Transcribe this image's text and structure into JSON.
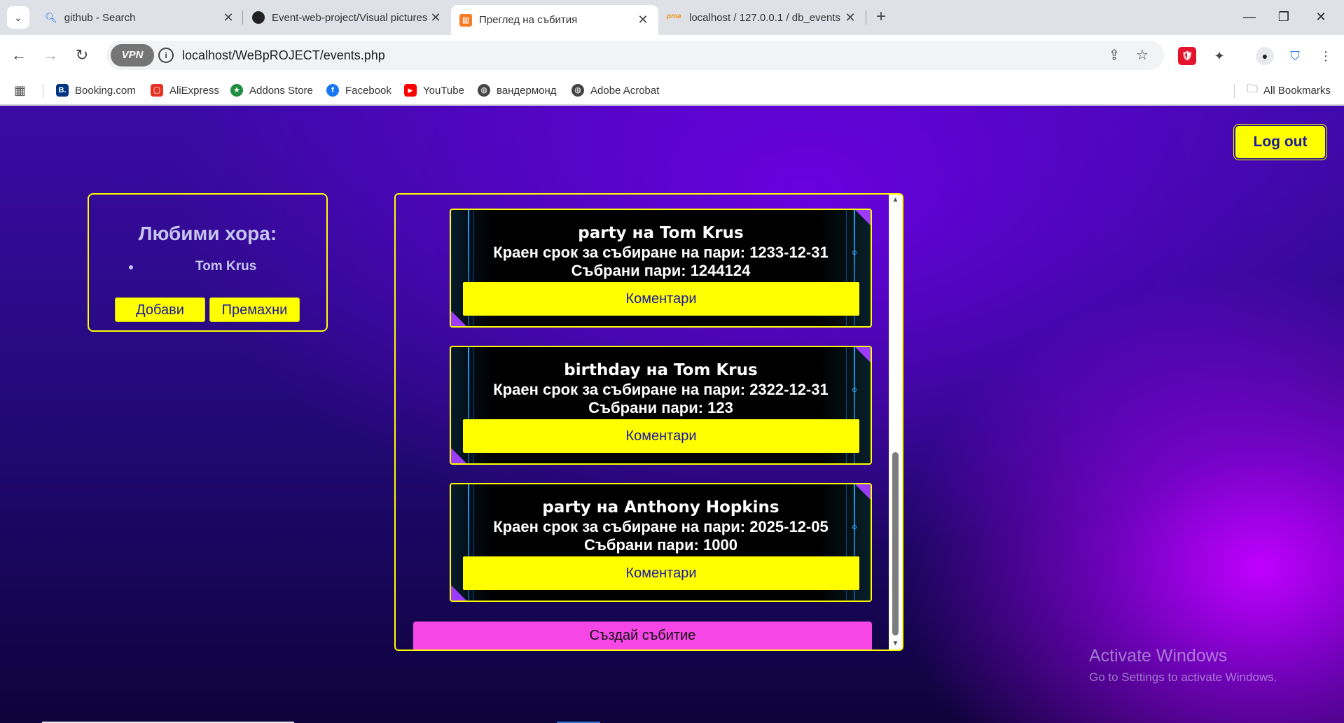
{
  "tabs": [
    {
      "title": "github - Search",
      "icon": "search-icon",
      "active": false
    },
    {
      "title": "Event-web-project/Visual pictures",
      "icon": "github-icon",
      "active": false
    },
    {
      "title": "Преглед на събития",
      "icon": "xampp-icon",
      "active": true
    },
    {
      "title": "localhost / 127.0.0.1 / db_events",
      "icon": "phpmyadmin-icon",
      "active": false
    }
  ],
  "toolbar": {
    "vpn_label": "VPN",
    "url": "localhost/WeBpROJECT/events.php"
  },
  "bookmarks": [
    {
      "label": "Booking.com",
      "icon": "booking-icon",
      "color": "#003580"
    },
    {
      "label": "AliExpress",
      "icon": "aliexpress-icon",
      "color": "#e43225"
    },
    {
      "label": "Addons Store",
      "icon": "addons-icon",
      "color": "#1e8e3e"
    },
    {
      "label": "Facebook",
      "icon": "facebook-icon",
      "color": "#1877f2"
    },
    {
      "label": "YouTube",
      "icon": "youtube-icon",
      "color": "#ff0000"
    },
    {
      "label": "вандермонд",
      "icon": "globe-icon",
      "color": "#444444"
    },
    {
      "label": "Adobe Acrobat",
      "icon": "globe-icon",
      "color": "#444444"
    }
  ],
  "all_bookmarks": "All Bookmarks",
  "page": {
    "logout_label": "Log out",
    "favorites": {
      "title": "Любими хора:",
      "items": [
        "Tom Krus"
      ],
      "add_label": "Добави",
      "remove_label": "Премахни"
    },
    "events": [
      {
        "title": "party на Tom Krus",
        "deadline": "Краен срок за събиране на пари: 1233-12-31",
        "collected": "Събрани пари: 1244124",
        "comments_label": "Коментари"
      },
      {
        "title": "birthday на Tom Krus",
        "deadline": "Краен срок за събиране на пари: 2322-12-31",
        "collected": "Събрани пари: 123",
        "comments_label": "Коментари"
      },
      {
        "title": "party на Anthony Hopkins",
        "deadline": "Краен срок за събиране на пари: 2025-12-05",
        "collected": "Събрани пари: 1000",
        "comments_label": "Коментари"
      }
    ],
    "create_label": "Създай събитие"
  },
  "watermark": {
    "line1": "Activate Windows",
    "line2": "Go to Settings to activate Windows."
  },
  "colors": {
    "accent_yellow": "#ffff00",
    "create_pink": "#f646e6",
    "link_blue": "#1a1aa0"
  }
}
